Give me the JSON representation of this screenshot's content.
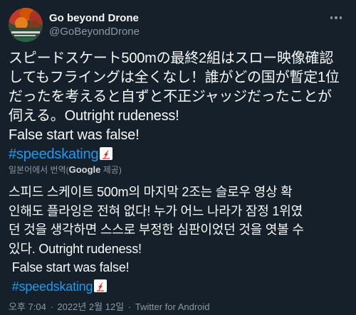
{
  "author": {
    "display_name": "Go beyond Drone",
    "handle": "@GoBeyondDrone",
    "avatar_icon": "autumn-landscape-avatar"
  },
  "more_icon": "more-horizontal-icon",
  "original": {
    "lines": [
      "スピードスケート500mの最終2組はスロー映像確認",
      "してもフライングは全くなし！誰がどの国が暫定1位",
      "だったを考えると自ずと不正ジャッジだったことが",
      "伺える。Outright rudeness!",
      "False start was false!"
    ],
    "hashtag": "#speedskating",
    "hashtag_emoji": "speed-skating-emoji"
  },
  "translation": {
    "prefix": "일본어에서 번역(",
    "provider": "Google",
    "suffix": " 제공)"
  },
  "translated": {
    "lines": [
      "스피드 스케이트 500m의 마지막 2조는 슬로우 영상 확",
      "인해도 플라잉은 전혀 없다! 누가 어느 나라가 잠정 1위였",
      "던 것을 생각하면 스스로 부정한 심판이었던 것을 엿볼 수",
      "있다. Outright rudeness!",
      " False start was false!"
    ],
    "hashtag": " #speedskating"
  },
  "footer": {
    "time": "오후 7:04",
    "separator1": "·",
    "date": "2022년 2월 12일",
    "separator2": "·",
    "source": "Twitter for Android"
  },
  "colors": {
    "background": "#15202b",
    "text": "#f7f9f9",
    "secondary": "#8b98a5",
    "link": "#1d9bf0",
    "emoji_red": "#e0302f"
  }
}
